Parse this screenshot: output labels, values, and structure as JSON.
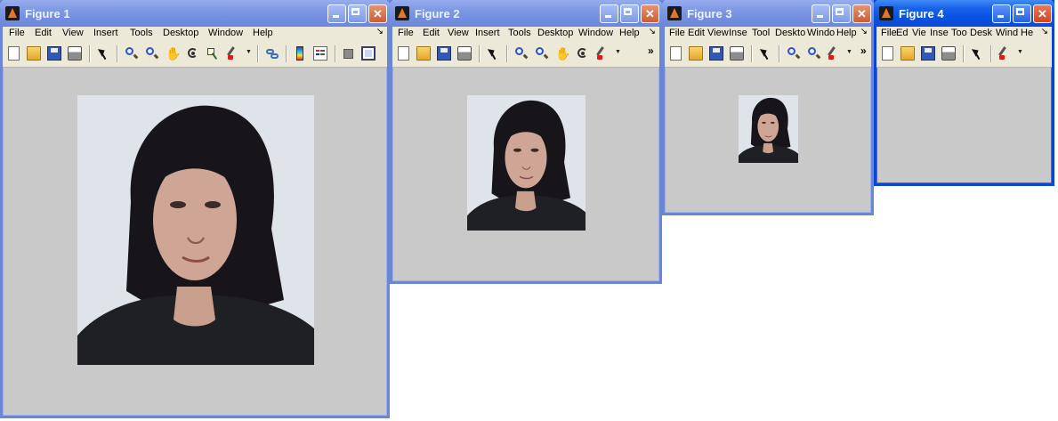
{
  "menu_labels_full": [
    "File",
    "Edit",
    "View",
    "Insert",
    "Tools",
    "Desktop",
    "Window",
    "Help"
  ],
  "menu_labels_fig3": [
    "File",
    "Edit",
    "View",
    "Inse",
    "Tool",
    "Deskto",
    "Windo",
    "Help"
  ],
  "menu_labels_fig4": [
    "File",
    "Ed",
    "Vie",
    "Inse",
    "Too",
    "Desk",
    "Wind",
    "He"
  ],
  "overflow_chevron": "»",
  "menu_end_glyph": "↘",
  "windows": [
    {
      "title": "Figure 1",
      "active": false,
      "image_scale": "full"
    },
    {
      "title": "Figure 2",
      "active": false,
      "image_scale": "half"
    },
    {
      "title": "Figure 3",
      "active": false,
      "image_scale": "quarter"
    },
    {
      "title": "Figure 4",
      "active": true,
      "image_scale": "tiny"
    }
  ],
  "colors": {
    "figure_background": "#c9c9c9",
    "inactive_title": "#7f9be6",
    "active_title": "#0955e4",
    "desktop": "#ffffff"
  }
}
